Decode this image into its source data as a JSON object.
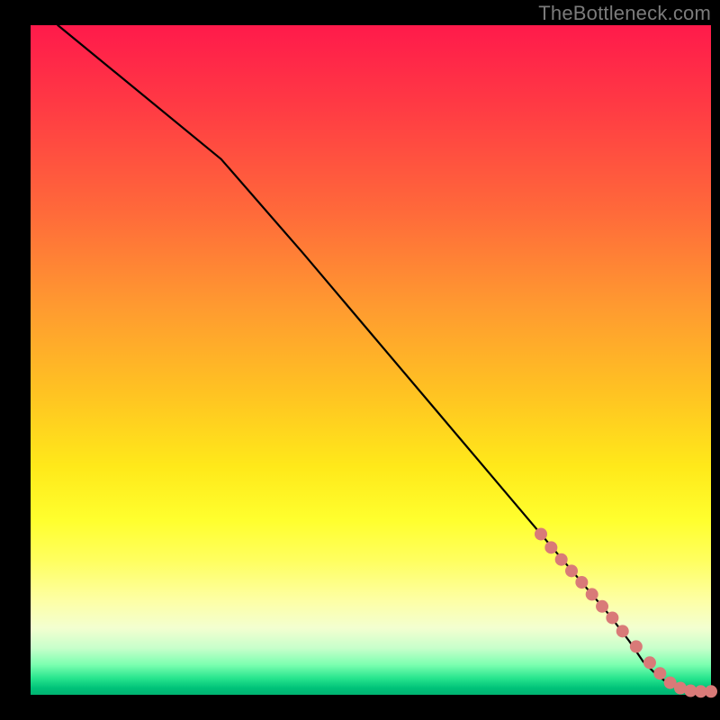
{
  "watermark": "TheBottleneck.com",
  "chart_data": {
    "type": "line",
    "title": "",
    "xlabel": "",
    "ylabel": "",
    "xlim": [
      0,
      100
    ],
    "ylim": [
      0,
      100
    ],
    "series": [
      {
        "name": "curve",
        "x": [
          4,
          28,
          40,
          50,
          60,
          70,
          75,
          80,
          85,
          88,
          90,
          92,
          94,
          96,
          98,
          100
        ],
        "y": [
          100,
          80,
          66,
          54,
          42,
          30,
          24,
          18,
          12,
          8,
          5,
          3,
          1.5,
          0.8,
          0.5,
          0.5
        ]
      }
    ],
    "points": {
      "name": "dots",
      "color": "#d97a78",
      "x": [
        75,
        76.5,
        78,
        79.5,
        81,
        82.5,
        84,
        85.5,
        87,
        89,
        91,
        92.5,
        94,
        95.5,
        97,
        98.5,
        100
      ],
      "y": [
        24,
        22,
        20.2,
        18.5,
        16.8,
        15,
        13.2,
        11.5,
        9.5,
        7.2,
        4.8,
        3.2,
        1.8,
        1,
        0.6,
        0.5,
        0.5
      ]
    }
  }
}
